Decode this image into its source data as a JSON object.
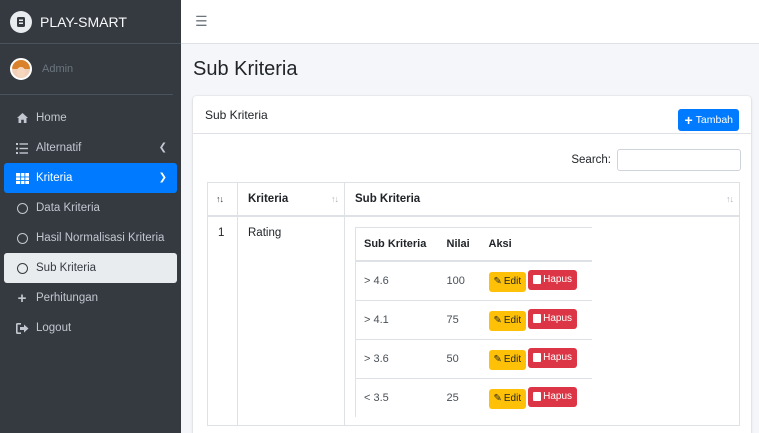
{
  "brand": {
    "name": "PLAY-SMART"
  },
  "user": {
    "name": "Admin"
  },
  "sidebar": {
    "items": [
      {
        "label": "Home"
      },
      {
        "label": "Alternatif"
      },
      {
        "label": "Kriteria"
      },
      {
        "label": "Data Kriteria"
      },
      {
        "label": "Hasil Normalisasi Kriteria"
      },
      {
        "label": "Sub Kriteria"
      },
      {
        "label": "Perhitungan"
      },
      {
        "label": "Logout"
      }
    ]
  },
  "page": {
    "title": "Sub Kriteria"
  },
  "card": {
    "title": "Sub Kriteria",
    "add_button": "Tambah",
    "search_label": "Search:"
  },
  "table": {
    "headers": [
      "Kriteria",
      "Sub Kriteria"
    ],
    "rows": [
      {
        "no": "1",
        "kriteria": "Rating",
        "sub_headers": [
          "Sub Kriteria",
          "Nilai",
          "Aksi"
        ],
        "subs": [
          {
            "name": "> 4.6",
            "nilai": "100"
          },
          {
            "name": "> 4.1",
            "nilai": "75"
          },
          {
            "name": "> 3.6",
            "nilai": "50"
          },
          {
            "name": "< 3.5",
            "nilai": "25"
          }
        ]
      }
    ]
  },
  "actions": {
    "edit": "Edit",
    "delete": "Hapus"
  }
}
